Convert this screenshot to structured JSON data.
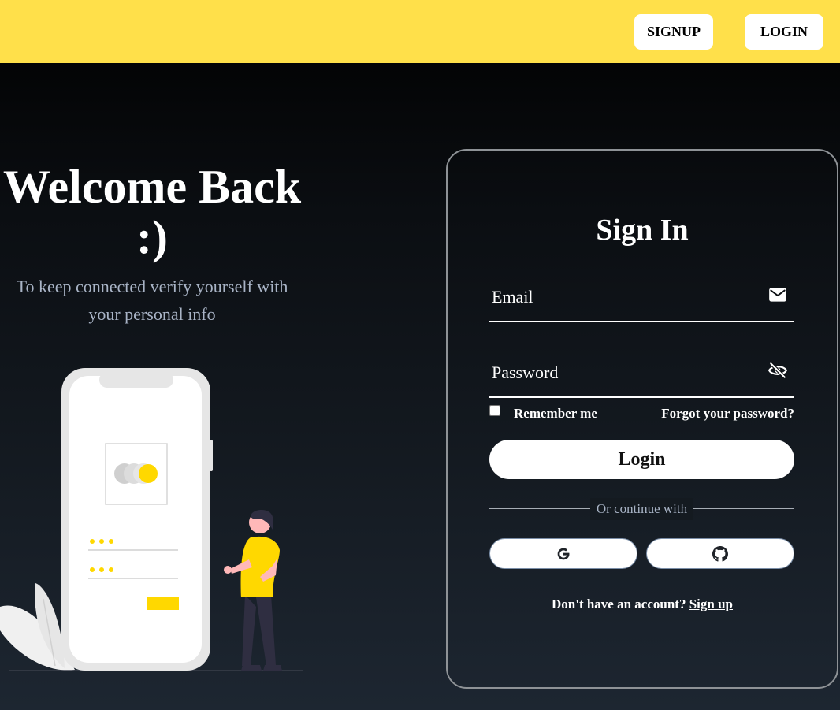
{
  "nav": {
    "signup_label": "SIGNUP",
    "login_label": "LOGIN"
  },
  "hero": {
    "title": "Welcome Back :)",
    "subtitle": "To keep connected verify yourself with your personal info"
  },
  "signin": {
    "title": "Sign In",
    "email_placeholder": "Email",
    "password_placeholder": "Password",
    "remember_label": "Remember me",
    "forgot_label": "Forgot your password?",
    "login_label": "Login",
    "divider_text": "Or continue with",
    "no_account_text": "Don't have an account?",
    "signup_link": "Sign up"
  },
  "colors": {
    "topbar": "#ffe04a",
    "accent_yellow": "#ffd800",
    "card_border": "#8e9296",
    "subtitle": "#a9b4c6"
  },
  "icons": {
    "email": "envelope-icon",
    "password": "eye-slash-icon",
    "google": "google-icon",
    "github": "github-icon"
  }
}
